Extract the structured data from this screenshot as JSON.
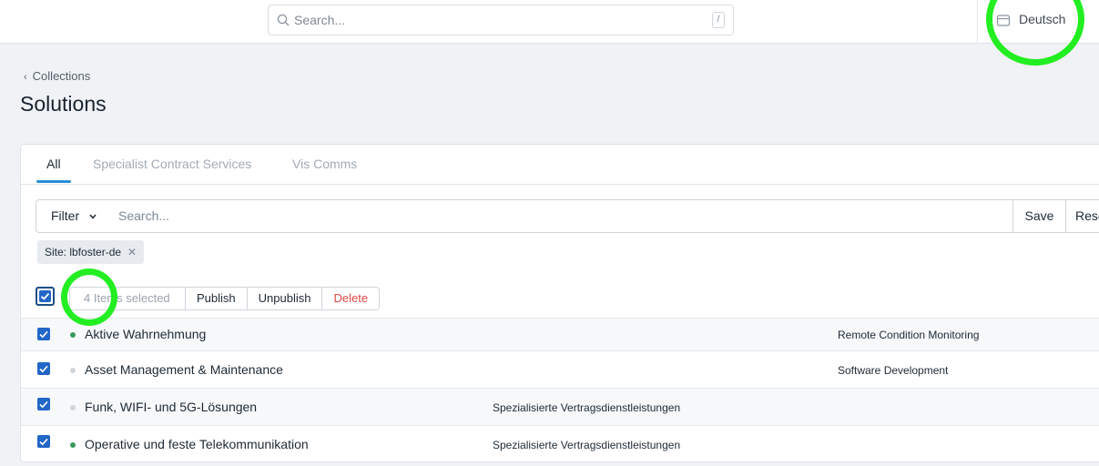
{
  "topbar": {
    "search_placeholder": "Search...",
    "search_shortcut": "/",
    "locale": "Deutsch"
  },
  "breadcrumb": {
    "label": "Collections"
  },
  "page": {
    "title": "Solutions"
  },
  "tabs": [
    {
      "label": "All",
      "active": true
    },
    {
      "label": "Specialist Contract Services",
      "active": false
    },
    {
      "label": "Vis Comms",
      "active": false
    }
  ],
  "filter": {
    "button_label": "Filter",
    "search_placeholder": "Search...",
    "save_label": "Save",
    "reset_label": "Rese"
  },
  "chips": [
    {
      "label": "Site: lbfoster-de"
    }
  ],
  "bulk": {
    "selected_count": "4 Items selected",
    "publish_label": "Publish",
    "unpublish_label": "Unpublish",
    "delete_label": "Delete"
  },
  "rows": [
    {
      "title": "Aktive Wahrnehmung",
      "category": "Remote Condition Monitoring",
      "published": true,
      "checked": true
    },
    {
      "title": "Asset Management & Maintenance",
      "category": "Software Development",
      "published": false,
      "checked": true
    },
    {
      "title": "Funk, WIFI- und 5G-Lösungen",
      "category": "Spezialisierte Vertragsdienstleistungen",
      "published": false,
      "checked": true
    },
    {
      "title": "Operative und feste Telekommunikation",
      "category": "Spezialisierte Vertragsdienstleistungen",
      "published": true,
      "checked": true
    }
  ],
  "colors": {
    "accent": "#2a8fd8",
    "checkbox": "#2266c6",
    "published_dot": "#3a9a5e",
    "draft_dot": "#d0d5da",
    "danger": "#e04848",
    "annotation": "#22ee22"
  }
}
